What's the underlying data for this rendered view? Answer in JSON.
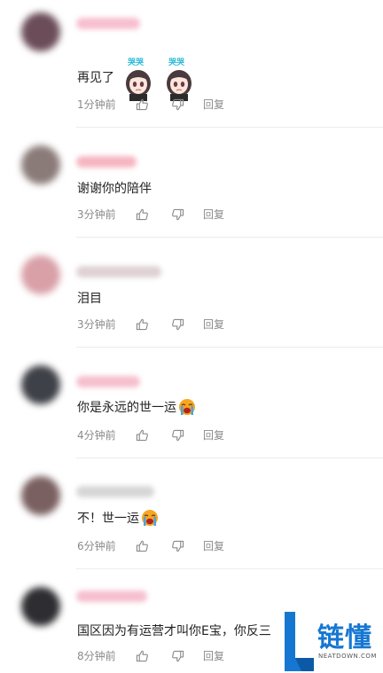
{
  "comments": [
    {
      "text": "再见了",
      "time": "1分钟前",
      "reply": "回复",
      "avatar_color": "#6b4d5a",
      "name_color": "#f6b3c6",
      "sticker": "crying-anime-girl-sticker",
      "sticker_caption": "哭哭"
    },
    {
      "text": "谢谢你的陪伴",
      "time": "3分钟前",
      "reply": "回复",
      "avatar_color": "#8a7b78",
      "name_color": "#f4a8b6"
    },
    {
      "text": "泪目",
      "time": "3分钟前",
      "reply": "回复",
      "avatar_color": "#d9a0a8",
      "name_color": "#d8c9cc"
    },
    {
      "text": "你是永远的世一运",
      "time": "4分钟前",
      "reply": "回复",
      "avatar_color": "#3f4148",
      "name_color": "#f4b4c4",
      "emoji": "crying-emoji"
    },
    {
      "text": "不！世一运",
      "time": "6分钟前",
      "reply": "回复",
      "avatar_color": "#7a6060",
      "name_color": "#cfcfcf",
      "emoji": "crying-emoji"
    },
    {
      "text": "国区因为有运营才叫你E宝，你反三",
      "time": "8分钟前",
      "reply": "回复",
      "avatar_color": "#2e2e32",
      "name_color": "#f4b4c8"
    }
  ],
  "watermark": {
    "logo_text": "链懂",
    "sub_text": "NEATDOWN.COM",
    "brand_color": "#1677d2"
  },
  "icons": {
    "like": "thumbs-up-icon",
    "dislike": "thumbs-down-icon"
  }
}
